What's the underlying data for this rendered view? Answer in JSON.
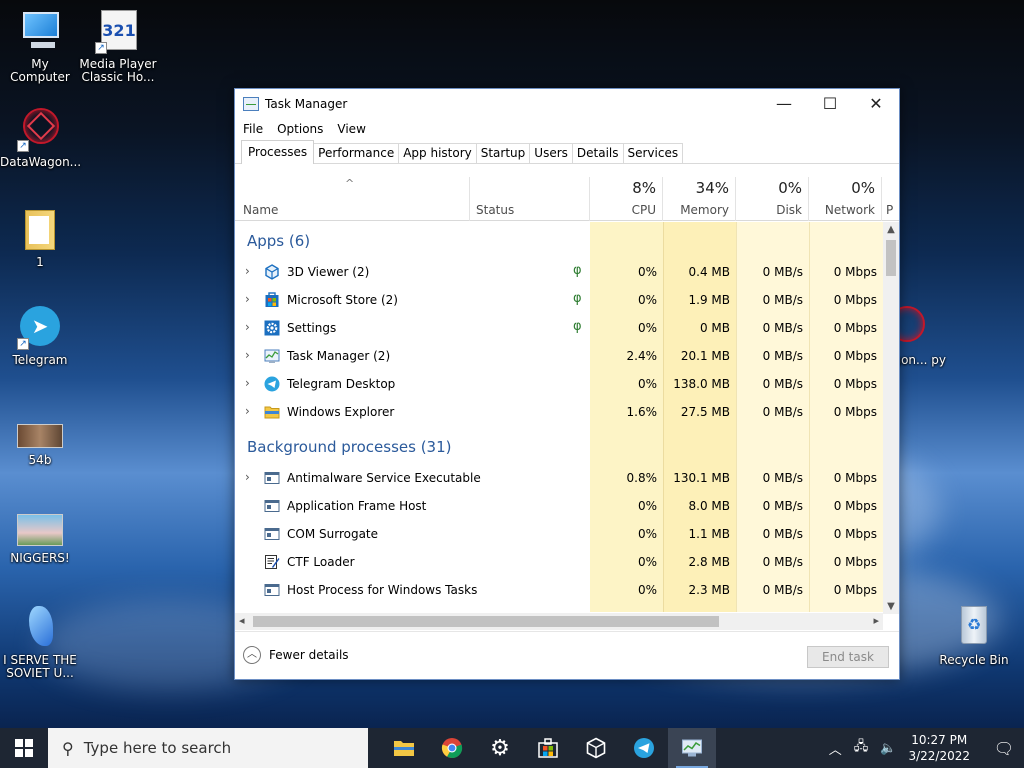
{
  "desktop": {
    "icons": [
      {
        "label": "My Computer"
      },
      {
        "label": "Media Player Classic Ho..."
      },
      {
        "label": "DataWagon..."
      },
      {
        "label": "1"
      },
      {
        "label": "Telegram"
      },
      {
        "label": "54b"
      },
      {
        "label": "NIGGERS!"
      },
      {
        "label": "I SERVE THE SOVIET U..."
      },
      {
        "label": "Recycle Bin"
      },
      {
        "label": "agon... py"
      }
    ]
  },
  "window": {
    "title": "Task Manager",
    "menu": [
      "File",
      "Options",
      "View"
    ],
    "tabs": [
      "Processes",
      "Performance",
      "App history",
      "Startup",
      "Users",
      "Details",
      "Services"
    ],
    "active_tab": "Processes",
    "columns": {
      "name": "Name",
      "status": "Status",
      "cpu": {
        "pct": "8%",
        "label": "CPU"
      },
      "memory": {
        "pct": "34%",
        "label": "Memory"
      },
      "disk": {
        "pct": "0%",
        "label": "Disk"
      },
      "network": {
        "pct": "0%",
        "label": "Network"
      },
      "power": "P"
    },
    "apps_header": "Apps (6)",
    "apps": [
      {
        "name": "3D Viewer (2)",
        "cpu": "0%",
        "mem": "0.4 MB",
        "disk": "0 MB/s",
        "net": "0 Mbps",
        "icon": "cube-icon"
      },
      {
        "name": "Microsoft Store (2)",
        "cpu": "0%",
        "mem": "1.9 MB",
        "disk": "0 MB/s",
        "net": "0 Mbps",
        "icon": "store-icon"
      },
      {
        "name": "Settings",
        "cpu": "0%",
        "mem": "0 MB",
        "disk": "0 MB/s",
        "net": "0 Mbps",
        "icon": "gear-icon"
      },
      {
        "name": "Task Manager (2)",
        "cpu": "2.4%",
        "mem": "20.1 MB",
        "disk": "0 MB/s",
        "net": "0 Mbps",
        "icon": "taskmgr-icon"
      },
      {
        "name": "Telegram Desktop",
        "cpu": "0%",
        "mem": "138.0 MB",
        "disk": "0 MB/s",
        "net": "0 Mbps",
        "icon": "telegram-icon"
      },
      {
        "name": "Windows Explorer",
        "cpu": "1.6%",
        "mem": "27.5 MB",
        "disk": "0 MB/s",
        "net": "0 Mbps",
        "icon": "folder-icon"
      }
    ],
    "bg_header": "Background processes (31)",
    "background": [
      {
        "name": "Antimalware Service Executable",
        "cpu": "0.8%",
        "mem": "130.1 MB",
        "disk": "0 MB/s",
        "net": "0 Mbps"
      },
      {
        "name": "Application Frame Host",
        "cpu": "0%",
        "mem": "8.0 MB",
        "disk": "0 MB/s",
        "net": "0 Mbps"
      },
      {
        "name": "COM Surrogate",
        "cpu": "0%",
        "mem": "1.1 MB",
        "disk": "0 MB/s",
        "net": "0 Mbps"
      },
      {
        "name": "CTF Loader",
        "cpu": "0%",
        "mem": "2.8 MB",
        "disk": "0 MB/s",
        "net": "0 Mbps"
      },
      {
        "name": "Host Process for Windows Tasks",
        "cpu": "0%",
        "mem": "2.3 MB",
        "disk": "0 MB/s",
        "net": "0 Mbps"
      }
    ],
    "fewer_details": "Fewer details",
    "end_task": "End task"
  },
  "taskbar": {
    "search_placeholder": "Type here to search",
    "time": "10:27 PM",
    "date": "3/22/2022"
  },
  "colors": {
    "cpu_shade": "#fdf4c6",
    "col_shade": "#fff8d9",
    "section_blue": "#2b5a9b"
  }
}
